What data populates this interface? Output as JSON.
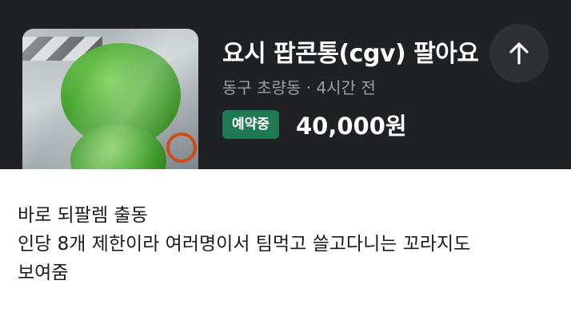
{
  "listing": {
    "title": "요시 팝콘통(cgv) 팔아요",
    "location": "동구 초량동",
    "separator": "·",
    "time": "4시간 전",
    "badge": "예약중",
    "price": "40,000원"
  },
  "post": {
    "lines": [
      "바로 되팔렘 출동",
      "인당 8개 제한이라 여러명이서 팀먹고 쓸고다니는 꼬라지도",
      "보여줌"
    ]
  },
  "icons": {
    "scroll_up": "arrow-up-icon"
  },
  "colors": {
    "card_bg": "#202124",
    "badge_bg": "#1f7a54"
  }
}
